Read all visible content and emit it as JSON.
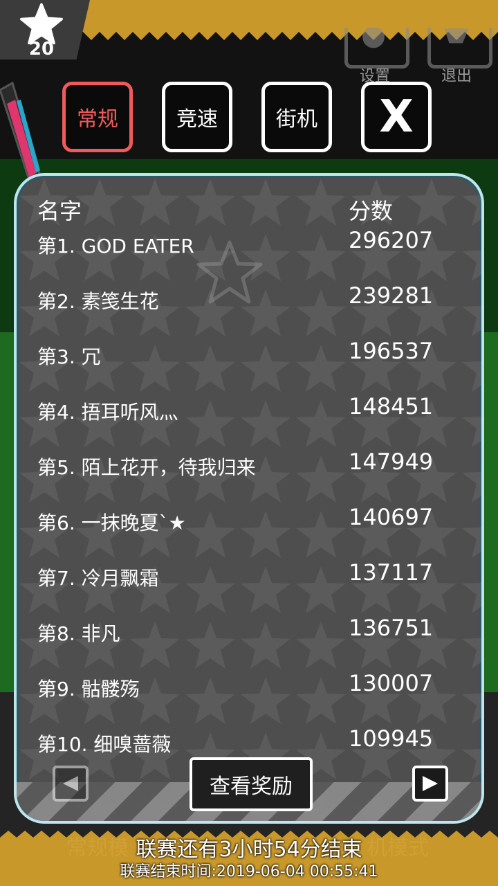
{
  "hud": {
    "star_count": "20",
    "settings_label": "设置",
    "exit_label": "退出"
  },
  "tabs": [
    {
      "label": "常规",
      "active": true
    },
    {
      "label": "竞速",
      "active": false
    },
    {
      "label": "街机",
      "active": false
    },
    {
      "label": "X",
      "active": false
    }
  ],
  "leaderboard": {
    "name_header": "名字",
    "score_header": "分数",
    "rows": [
      {
        "name": "第1. GOD EATER",
        "score": "296207"
      },
      {
        "name": "第2. 素笺生花",
        "score": "239281"
      },
      {
        "name": "第3. 冗",
        "score": "196537"
      },
      {
        "name": "第4. 捂耳听风灬",
        "score": "148451"
      },
      {
        "name": "第5. 陌上花开，待我归来",
        "score": "147949"
      },
      {
        "name": "第6. 一抹晚夏`★",
        "score": "140697"
      },
      {
        "name": "第7. 冷月飘霜",
        "score": "137117"
      },
      {
        "name": "第8. 非凡",
        "score": "136751"
      },
      {
        "name": "第9. 骷髅殇",
        "score": "130007"
      },
      {
        "name": "第10. 细嗅蔷薇",
        "score": "109945"
      }
    ],
    "reward_button": "查看奖励"
  },
  "footer": {
    "countdown": "联赛还有3小时54分结束",
    "end_time": "联赛结束时间:2019-06-04 00:55:41",
    "ghost_left": "常规模",
    "ghost_right": "机模式"
  },
  "colors": {
    "gold": "#c9982b",
    "active_tab": "#ef5b5b",
    "panel_border": "#bfe6ee"
  }
}
